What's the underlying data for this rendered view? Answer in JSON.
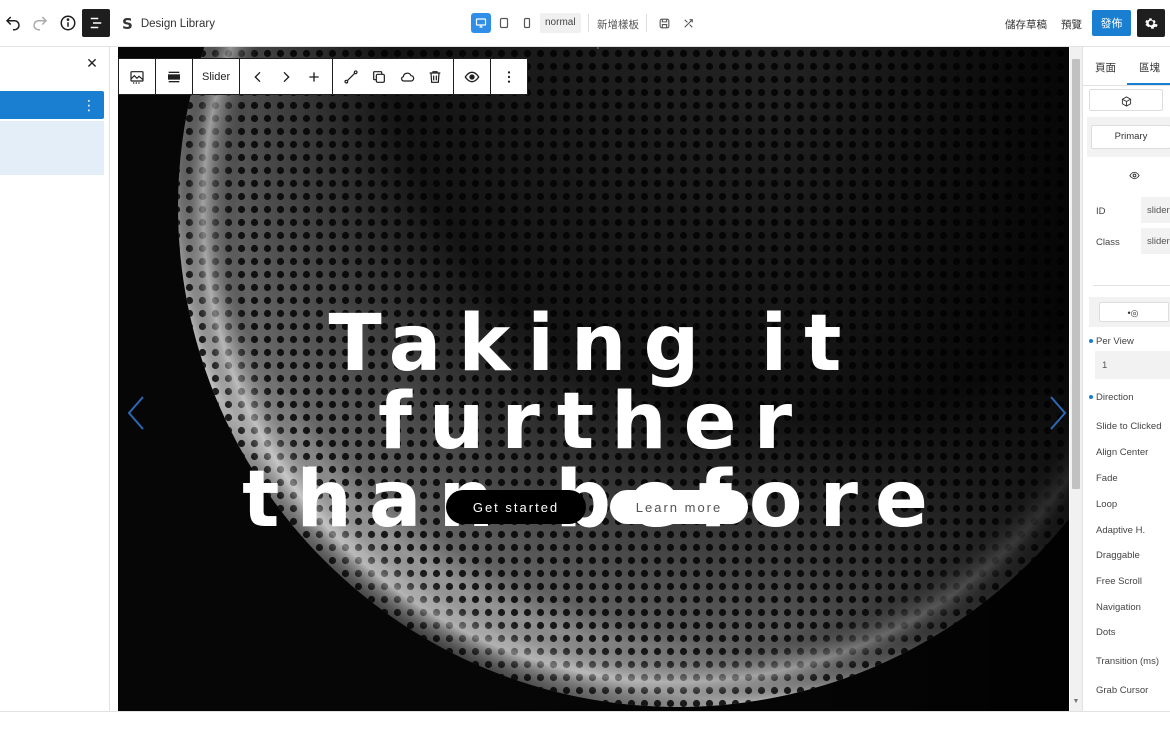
{
  "app": {
    "brand_name": "Design Library",
    "brand_logo": "S",
    "device_mode": "normal",
    "add_template_label": "新增樣板",
    "save_draft_label": "儲存草稿",
    "preview_label": "預覽",
    "publish_label": "發佈"
  },
  "block_toolbar": {
    "block_name": "Slider"
  },
  "hero": {
    "title_line1": "Taking it further",
    "title_line2": "than before",
    "primary_button": "Get started",
    "secondary_button": "Learn more"
  },
  "right_panel": {
    "tabs": [
      "頁面",
      "區塊"
    ],
    "active_tab": "區塊",
    "style_button": "Primary",
    "id_label": "ID",
    "id_value": "slider",
    "class_label": "Class",
    "class_value": "slider",
    "per_view_label": "Per View",
    "per_view_value": "1",
    "options": [
      "Direction",
      "Slide to Clicked",
      "Align Center",
      "Fade",
      "Loop",
      "Adaptive H.",
      "Draggable",
      "Free Scroll",
      "Navigation",
      "Dots",
      "Transition (ms)",
      "Grab Cursor"
    ]
  },
  "colors": {
    "accent": "#1a7fd0",
    "canvas_bg": "#060606",
    "arrow": "#2d68b8"
  }
}
